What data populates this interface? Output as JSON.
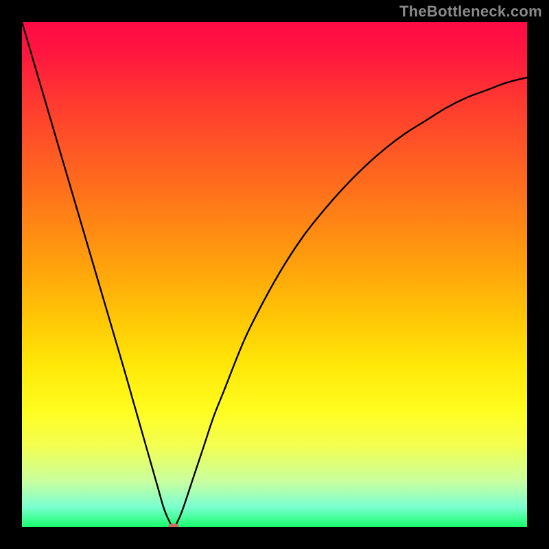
{
  "watermark": "TheBottleneck.com",
  "colors": {
    "frame": "#000000",
    "curve": "#000000",
    "marker": "#cf6b6b",
    "watermark": "#8a8a8a"
  },
  "chart_data": {
    "type": "line",
    "title": "",
    "xlabel": "",
    "ylabel": "",
    "xlim": [
      0,
      100
    ],
    "ylim": [
      0,
      100
    ],
    "grid": false,
    "series": [
      {
        "name": "bottleneck-curve",
        "x": [
          0,
          5,
          10,
          15,
          20,
          22,
          24,
          26,
          27,
          28,
          29,
          30,
          31,
          32,
          34,
          36,
          38,
          40,
          44,
          48,
          52,
          56,
          60,
          64,
          68,
          72,
          76,
          80,
          84,
          88,
          92,
          96,
          100
        ],
        "y": [
          100,
          83,
          66,
          49,
          32,
          25,
          18,
          11,
          7.5,
          4,
          1.5,
          0,
          1.5,
          4,
          10,
          16,
          22,
          27,
          37,
          45,
          52,
          58,
          63,
          67.5,
          71.5,
          75,
          78,
          80.5,
          83,
          85,
          86.5,
          88,
          89
        ]
      }
    ],
    "annotations": [
      {
        "name": "min-marker",
        "x": 30,
        "y": 0
      }
    ]
  }
}
